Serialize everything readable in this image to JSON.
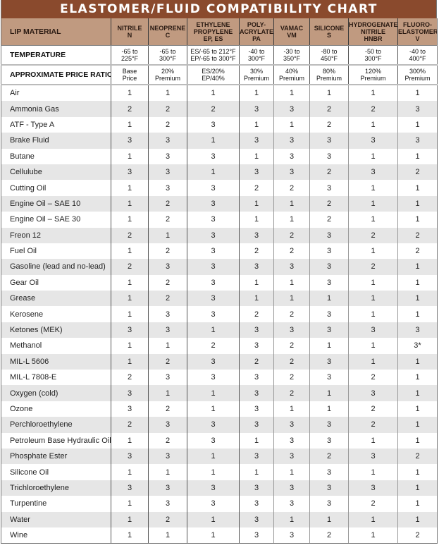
{
  "title": "ELASTOMER/FLUID COMPATIBILITY CHART",
  "header": {
    "row_label": "LIP MATERIAL",
    "columns": [
      {
        "line1": "NITRILE",
        "line2": "N",
        "line3": ""
      },
      {
        "line1": "NEOPRENE",
        "line2": "C",
        "line3": ""
      },
      {
        "line1": "ETHYLENE",
        "line2": "PROPYLENE",
        "line3": "EP, ES"
      },
      {
        "line1": "POLY-",
        "line2": "ACRYLATE",
        "line3": "PA"
      },
      {
        "line1": "VAMAC",
        "line2": "VM",
        "line3": ""
      },
      {
        "line1": "SILICONE",
        "line2": "S",
        "line3": ""
      },
      {
        "line1": "HYDROGENATED",
        "line2": "NITRILE",
        "line3": "HNBR"
      },
      {
        "line1": "FLUORO-",
        "line2": "ELASTOMER",
        "line3": "V"
      }
    ]
  },
  "temperature": {
    "label": "TEMPERATURE",
    "values": [
      {
        "a": "-65 to",
        "b": "225°F"
      },
      {
        "a": "-65 to",
        "b": "300°F"
      },
      {
        "a": "ES/-65 to 212°F",
        "b": "EP/-65 to 300°F"
      },
      {
        "a": "-40 to",
        "b": "300°F"
      },
      {
        "a": "-30 to",
        "b": "350°F"
      },
      {
        "a": "-80 to",
        "b": "450°F"
      },
      {
        "a": "-50 to",
        "b": "300°F"
      },
      {
        "a": "-40 to",
        "b": "400°F"
      }
    ]
  },
  "price": {
    "label": "APPROXIMATE PRICE RATIO",
    "values": [
      {
        "a": "Base",
        "b": "Price"
      },
      {
        "a": "20%",
        "b": "Premium"
      },
      {
        "a": "ES/20%",
        "b": "EP/40%"
      },
      {
        "a": "30%",
        "b": "Premium"
      },
      {
        "a": "40%",
        "b": "Premium"
      },
      {
        "a": "80%",
        "b": "Premium"
      },
      {
        "a": "120%",
        "b": "Premium"
      },
      {
        "a": "300%",
        "b": "Premium"
      }
    ]
  },
  "rows": [
    {
      "fluid": "Air",
      "ratings": [
        "1",
        "1",
        "1",
        "1",
        "1",
        "1",
        "1",
        "1"
      ]
    },
    {
      "fluid": "Ammonia Gas",
      "ratings": [
        "2",
        "2",
        "2",
        "3",
        "3",
        "2",
        "2",
        "3"
      ]
    },
    {
      "fluid": "ATF - Type A",
      "ratings": [
        "1",
        "2",
        "3",
        "1",
        "1",
        "2",
        "1",
        "1"
      ]
    },
    {
      "fluid": "Brake Fluid",
      "ratings": [
        "3",
        "3",
        "1",
        "3",
        "3",
        "3",
        "3",
        "3"
      ]
    },
    {
      "fluid": "Butane",
      "ratings": [
        "1",
        "3",
        "3",
        "1",
        "3",
        "3",
        "1",
        "1"
      ]
    },
    {
      "fluid": "Cellulube",
      "ratings": [
        "3",
        "3",
        "1",
        "3",
        "3",
        "2",
        "3",
        "2"
      ]
    },
    {
      "fluid": "Cutting Oil",
      "ratings": [
        "1",
        "3",
        "3",
        "2",
        "2",
        "3",
        "1",
        "1"
      ]
    },
    {
      "fluid": "Engine Oil – SAE 10",
      "ratings": [
        "1",
        "2",
        "3",
        "1",
        "1",
        "2",
        "1",
        "1"
      ]
    },
    {
      "fluid": "Engine Oil – SAE 30",
      "ratings": [
        "1",
        "2",
        "3",
        "1",
        "1",
        "2",
        "1",
        "1"
      ]
    },
    {
      "fluid": "Freon 12",
      "ratings": [
        "2",
        "1",
        "3",
        "3",
        "2",
        "3",
        "2",
        "2"
      ]
    },
    {
      "fluid": "Fuel Oil",
      "ratings": [
        "1",
        "2",
        "3",
        "2",
        "2",
        "3",
        "1",
        "2"
      ]
    },
    {
      "fluid": "Gasoline (lead and no-lead)",
      "ratings": [
        "2",
        "3",
        "3",
        "3",
        "3",
        "3",
        "2",
        "1"
      ]
    },
    {
      "fluid": "Gear Oil",
      "ratings": [
        "1",
        "2",
        "3",
        "1",
        "1",
        "3",
        "1",
        "1"
      ]
    },
    {
      "fluid": "Grease",
      "ratings": [
        "1",
        "2",
        "3",
        "1",
        "1",
        "1",
        "1",
        "1"
      ]
    },
    {
      "fluid": "Kerosene",
      "ratings": [
        "1",
        "3",
        "3",
        "2",
        "2",
        "3",
        "1",
        "1"
      ]
    },
    {
      "fluid": "Ketones (MEK)",
      "ratings": [
        "3",
        "3",
        "1",
        "3",
        "3",
        "3",
        "3",
        "3"
      ]
    },
    {
      "fluid": "Methanol",
      "ratings": [
        "1",
        "1",
        "2",
        "3",
        "2",
        "1",
        "1",
        "3*"
      ]
    },
    {
      "fluid": "MIL-L 5606",
      "ratings": [
        "1",
        "2",
        "3",
        "2",
        "2",
        "3",
        "1",
        "1"
      ]
    },
    {
      "fluid": "MIL-L 7808-E",
      "ratings": [
        "2",
        "3",
        "3",
        "3",
        "2",
        "3",
        "2",
        "1"
      ]
    },
    {
      "fluid": "Oxygen (cold)",
      "ratings": [
        "3",
        "1",
        "1",
        "3",
        "2",
        "1",
        "3",
        "1"
      ]
    },
    {
      "fluid": "Ozone",
      "ratings": [
        "3",
        "2",
        "1",
        "3",
        "1",
        "1",
        "2",
        "1"
      ]
    },
    {
      "fluid": "Perchloroethylene",
      "ratings": [
        "2",
        "3",
        "3",
        "3",
        "3",
        "3",
        "2",
        "1"
      ]
    },
    {
      "fluid": "Petroleum Base Hydraulic Oil",
      "ratings": [
        "1",
        "2",
        "3",
        "1",
        "3",
        "3",
        "1",
        "1"
      ]
    },
    {
      "fluid": "Phosphate Ester",
      "ratings": [
        "3",
        "3",
        "1",
        "3",
        "3",
        "2",
        "3",
        "2"
      ]
    },
    {
      "fluid": "Silicone Oil",
      "ratings": [
        "1",
        "1",
        "1",
        "1",
        "1",
        "3",
        "1",
        "1"
      ]
    },
    {
      "fluid": "Trichloroethylene",
      "ratings": [
        "3",
        "3",
        "3",
        "3",
        "3",
        "3",
        "3",
        "1"
      ]
    },
    {
      "fluid": "Turpentine",
      "ratings": [
        "1",
        "3",
        "3",
        "3",
        "3",
        "3",
        "2",
        "1"
      ]
    },
    {
      "fluid": "Water",
      "ratings": [
        "1",
        "2",
        "1",
        "3",
        "1",
        "1",
        "1",
        "1"
      ]
    },
    {
      "fluid": "Wine",
      "ratings": [
        "1",
        "1",
        "1",
        "3",
        "3",
        "2",
        "1",
        "2"
      ]
    }
  ],
  "colors": {
    "title_bg": "#8a4a2d",
    "header_bg": "#c09a80",
    "stripe": "#e6e6e6"
  }
}
